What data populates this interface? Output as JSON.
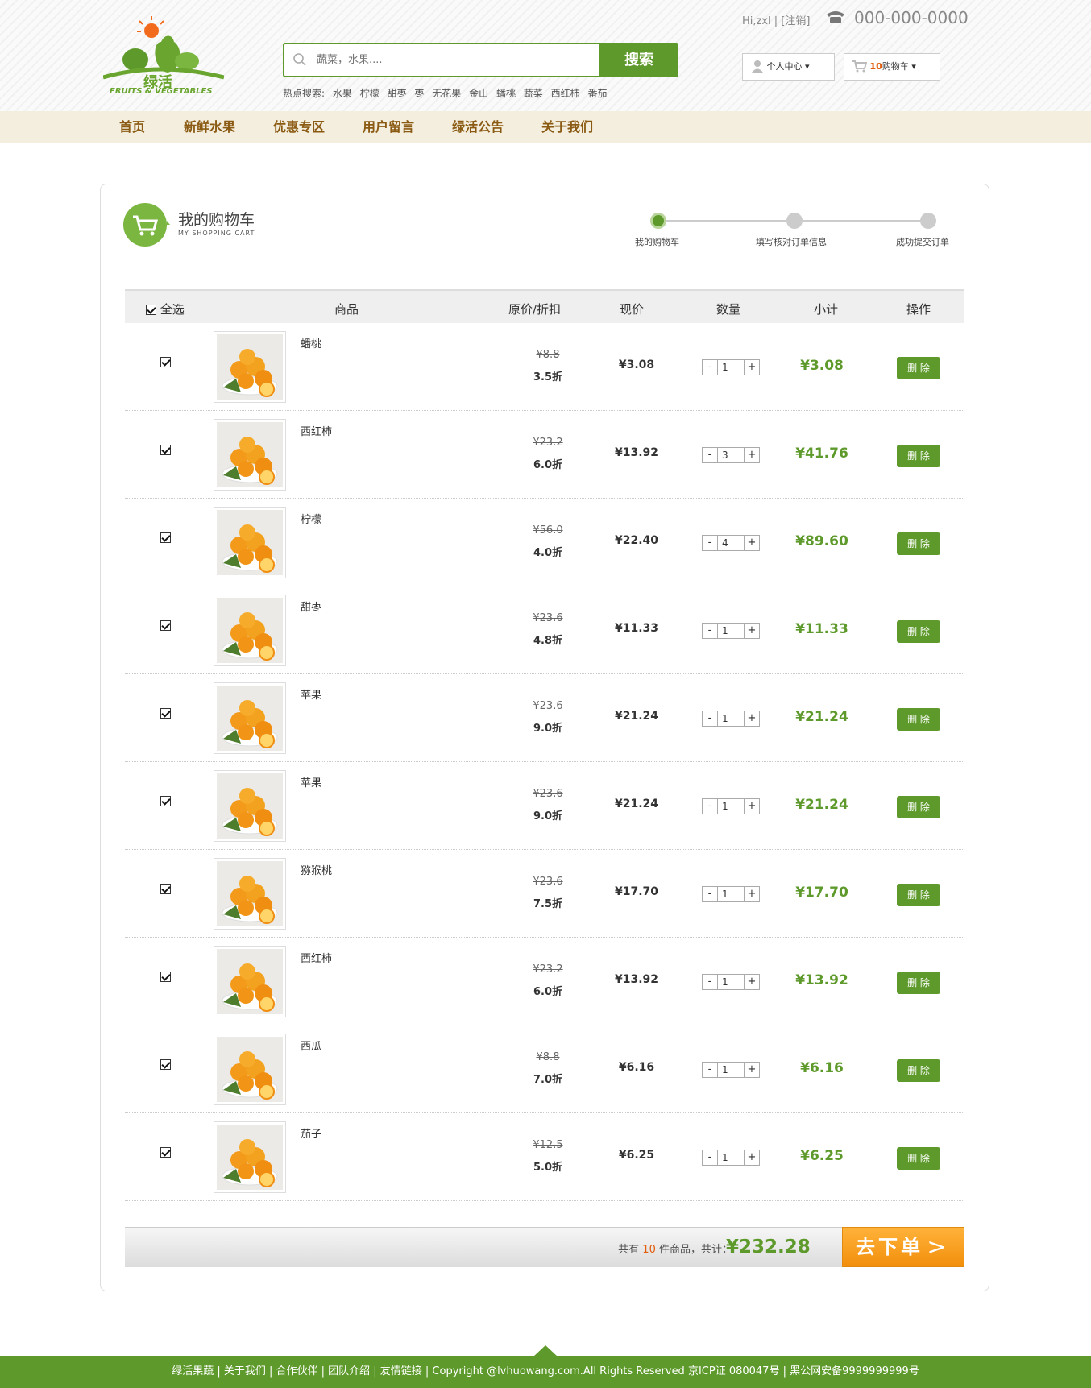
{
  "header": {
    "logo_text": "FRUITS & VEGETABLES",
    "logo_cn": "绿活",
    "search_placeholder": "蔬菜，水果....",
    "search_button": "搜索",
    "hot_label": "热点搜索:",
    "hot_terms": [
      "水果",
      "柠檬",
      "甜枣",
      "枣",
      "无花果",
      "金山",
      "蟠桃",
      "蔬菜",
      "西红柿",
      "番茄"
    ],
    "user_greeting": "Hi,zxl | [注销]",
    "phone": "000-000-0000",
    "user_center": "个人中心",
    "cart_count": "10",
    "cart_label": "购物车"
  },
  "nav": [
    "首页",
    "新鲜水果",
    "优惠专区",
    "用户留言",
    "绿活公告",
    "关于我们"
  ],
  "cart": {
    "title": "我的购物车",
    "subtitle": "MY SHOPPING CART",
    "steps": [
      "我的购物车",
      "填写核对订单信息",
      "成功提交订单"
    ],
    "headers": {
      "select_all": "全选",
      "product": "商品",
      "orig_discount": "原价/折扣",
      "price": "现价",
      "qty": "数量",
      "subtotal": "小计",
      "action": "操作"
    },
    "delete_label": "删 除",
    "items": [
      {
        "name": "蟠桃",
        "orig": "¥8.8",
        "discount": "3.5折",
        "price": "¥3.08",
        "qty": "1",
        "subtotal": "¥3.08"
      },
      {
        "name": "西红柿",
        "orig": "¥23.2",
        "discount": "6.0折",
        "price": "¥13.92",
        "qty": "3",
        "subtotal": "¥41.76"
      },
      {
        "name": "柠檬",
        "orig": "¥56.0",
        "discount": "4.0折",
        "price": "¥22.40",
        "qty": "4",
        "subtotal": "¥89.60"
      },
      {
        "name": "甜枣",
        "orig": "¥23.6",
        "discount": "4.8折",
        "price": "¥11.33",
        "qty": "1",
        "subtotal": "¥11.33"
      },
      {
        "name": "苹果",
        "orig": "¥23.6",
        "discount": "9.0折",
        "price": "¥21.24",
        "qty": "1",
        "subtotal": "¥21.24"
      },
      {
        "name": "苹果",
        "orig": "¥23.6",
        "discount": "9.0折",
        "price": "¥21.24",
        "qty": "1",
        "subtotal": "¥21.24"
      },
      {
        "name": "猕猴桃",
        "orig": "¥23.6",
        "discount": "7.5折",
        "price": "¥17.70",
        "qty": "1",
        "subtotal": "¥17.70"
      },
      {
        "name": "西红柿",
        "orig": "¥23.2",
        "discount": "6.0折",
        "price": "¥13.92",
        "qty": "1",
        "subtotal": "¥13.92"
      },
      {
        "name": "西瓜",
        "orig": "¥8.8",
        "discount": "7.0折",
        "price": "¥6.16",
        "qty": "1",
        "subtotal": "¥6.16"
      },
      {
        "name": "茄子",
        "orig": "¥12.5",
        "discount": "5.0折",
        "price": "¥6.25",
        "qty": "1",
        "subtotal": "¥6.25"
      }
    ],
    "summary_prefix": "共有",
    "summary_count": "10",
    "summary_suffix": "件商品，共计：",
    "total": "¥232.28",
    "order_button": "去下单"
  },
  "footer": "绿活果蔬 | 关于我们 | 合作伙伴 | 团队介绍 | 友情链接 | Copyright @lvhuowang.com.All Rights Reserved 京ICP证 080047号 | 黑公网安备9999999999号",
  "colors": {
    "brand_green": "#5e9a2b",
    "accent_orange": "#f28f0c",
    "nav_bg": "#f4eedf"
  }
}
